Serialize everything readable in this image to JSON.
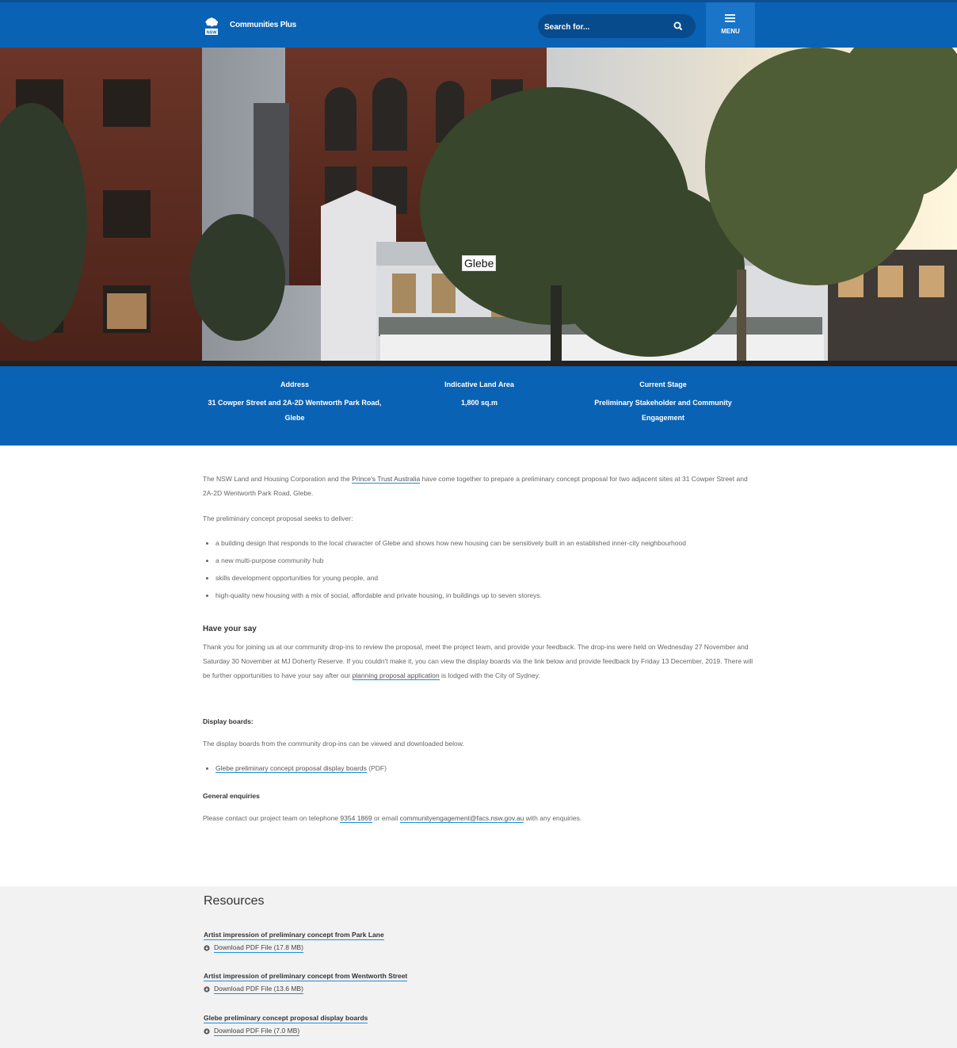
{
  "header": {
    "logo_label": "NSW",
    "site_title": "Communities Plus",
    "search_placeholder": "Search for...",
    "menu_label": "MENU"
  },
  "hero": {
    "title": "Glebe"
  },
  "info": [
    {
      "heading": "Address",
      "value": "31 Cowper Street and 2A-2D Wentworth Park Road, Glebe"
    },
    {
      "heading": "Indicative Land Area",
      "value": "1,800 sq.m"
    },
    {
      "heading": "Current Stage",
      "value": "Preliminary Stakeholder and Community Engagement"
    }
  ],
  "content": {
    "intro_before": "The NSW Land and Housing Corporation and the ",
    "intro_link": "Prince's Trust Australia",
    "intro_after": " have come together to prepare a preliminary concept proposal for two adjacent sites at 31 Cowper Street and 2A-2D Wentworth Park Road, Glebe.",
    "deliver_intro": "The preliminary concept proposal seeks to deliver:",
    "bullets": [
      "a building design that responds to the local character of Glebe and shows how new housing can be sensitively built in an established inner-city neighbourhood",
      "a new multi-purpose community hub",
      "skills development opportunities for young people, and",
      "high-quality new housing with a mix of social, affordable and private housing, in buildings up to seven storeys."
    ],
    "say_heading": "Have your say",
    "say_text_before": "Thank you for joining us at our community drop-ins to review the proposal, meet the project team, and provide your feedback. The drop-ins were held on Wednesday 27 November and Saturday 30 November at MJ Doherty Reserve. If you couldn't make it, you can view the display boards via the link below and provide feedback by Friday 13 December, 2019. There will be further opportunities to have your say after our ",
    "say_link": "planning proposal application",
    "say_text_after": " is lodged with the City of Sydney.",
    "boards_heading": "Display boards:",
    "boards_text": "The display boards from the community drop-ins can be viewed and downloaded below.",
    "boards_link": "Glebe preliminary concept proposal display boards",
    "boards_suffix": " (PDF)",
    "enq_heading": "General enquiries",
    "enq_before": "Please contact our project team on telephone ",
    "enq_phone": "9354 1869",
    "enq_mid": " or email ",
    "enq_email": "communityengagement@facs.nsw.gov.au",
    "enq_after": " with any enquiries."
  },
  "resources": {
    "title": "Resources",
    "items": [
      {
        "name": "Artist impression of preliminary concept from Park Lane",
        "download": "Download PDF File (17.8 MB)"
      },
      {
        "name": "Artist impression of preliminary concept from Wentworth Street",
        "download": "Download PDF File (13.6 MB)"
      },
      {
        "name": "Glebe preliminary concept proposal display boards",
        "download": "Download PDF File (7.0 MB)"
      }
    ]
  }
}
